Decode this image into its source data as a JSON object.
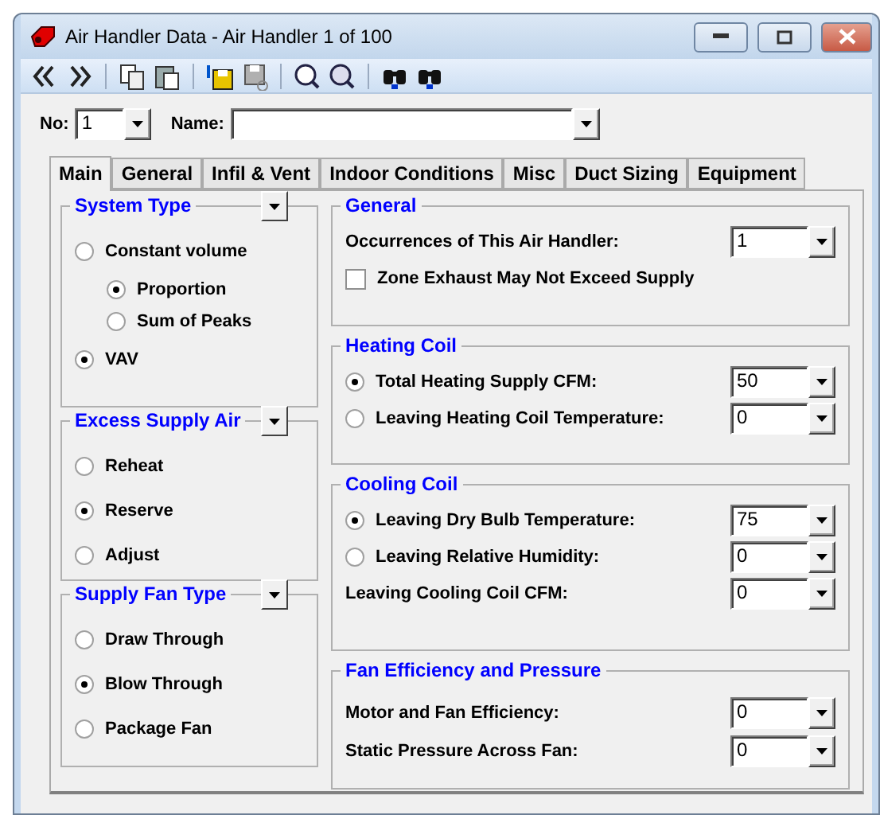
{
  "window": {
    "title": "Air Handler Data - Air Handler 1 of 100"
  },
  "record": {
    "no_label": "No:",
    "no_value": "1",
    "name_label": "Name:"
  },
  "tabs": [
    {
      "label": "Main",
      "selected": true
    },
    {
      "label": "General",
      "selected": false
    },
    {
      "label": "Infil & Vent",
      "selected": false
    },
    {
      "label": "Indoor Conditions",
      "selected": false
    },
    {
      "label": "Misc",
      "selected": false
    },
    {
      "label": "Duct Sizing",
      "selected": false
    },
    {
      "label": "Equipment",
      "selected": false
    }
  ],
  "left_groups": [
    {
      "title": "System Type",
      "has_menu": true,
      "options": [
        {
          "label": "Constant volume",
          "selected": false,
          "children": [
            {
              "label": "Proportion",
              "selected": true
            },
            {
              "label": "Sum of Peaks",
              "selected": false
            }
          ]
        },
        {
          "label": "VAV",
          "selected": true
        }
      ]
    },
    {
      "title": "Excess Supply Air",
      "has_menu": true,
      "options": [
        {
          "label": "Reheat",
          "selected": false
        },
        {
          "label": "Reserve",
          "selected": true
        },
        {
          "label": "Adjust",
          "selected": false
        }
      ]
    },
    {
      "title": "Supply Fan Type",
      "has_menu": true,
      "options": [
        {
          "label": "Draw Through",
          "selected": false
        },
        {
          "label": "Blow Through",
          "selected": true
        },
        {
          "label": "Package Fan",
          "selected": false
        }
      ]
    }
  ],
  "right_groups": [
    {
      "title": "General",
      "rows": [
        {
          "kind": "field",
          "label": "Occurrences of This Air Handler:",
          "value": "1"
        },
        {
          "kind": "checkbox",
          "label": "Zone Exhaust May Not Exceed Supply",
          "checked": false
        }
      ]
    },
    {
      "title": "Heating Coil",
      "rows": [
        {
          "kind": "radio",
          "label": "Total Heating Supply CFM:",
          "selected": true,
          "value": "50"
        },
        {
          "kind": "radio",
          "label": "Leaving Heating Coil Temperature:",
          "selected": false,
          "value": "0"
        }
      ]
    },
    {
      "title": "Cooling Coil",
      "rows": [
        {
          "kind": "radio",
          "label": "Leaving Dry Bulb Temperature:",
          "selected": true,
          "value": "75"
        },
        {
          "kind": "radio",
          "label": "Leaving Relative Humidity:",
          "selected": false,
          "value": "0"
        },
        {
          "kind": "field",
          "label": "Leaving Cooling Coil CFM:",
          "value": "0"
        }
      ]
    },
    {
      "title": "Fan Efficiency and Pressure",
      "rows": [
        {
          "kind": "field",
          "label": "Motor and Fan Efficiency:",
          "value": "0"
        },
        {
          "kind": "field",
          "label": "Static Pressure Across Fan:",
          "value": "0"
        }
      ]
    }
  ]
}
